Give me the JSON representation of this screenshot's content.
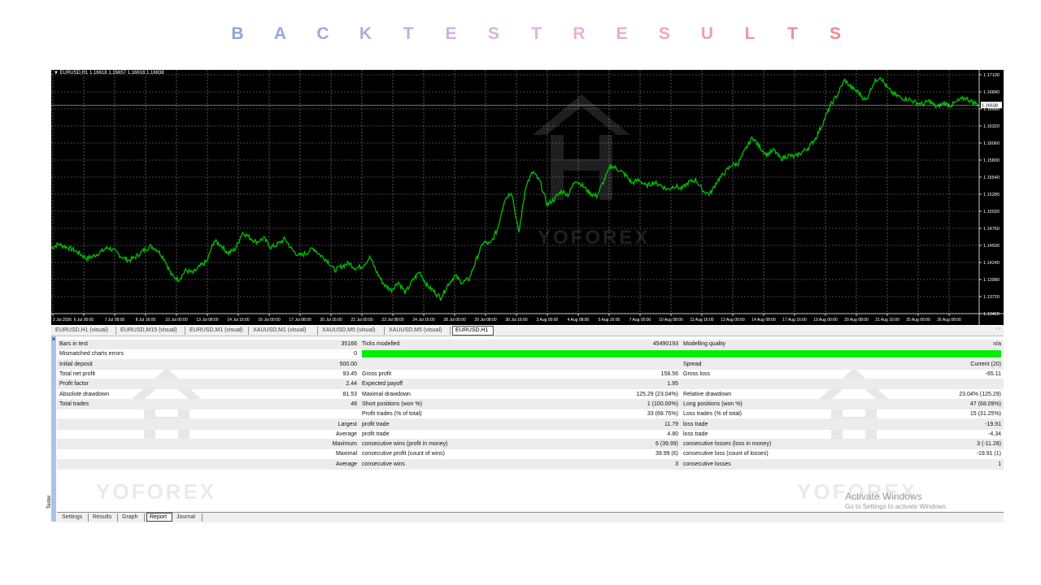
{
  "title": {
    "letters": [
      "B",
      "A",
      "C",
      "K",
      "T",
      "E",
      "S",
      "T",
      "R",
      "E",
      "S",
      "U",
      "L",
      "T",
      "S"
    ],
    "colors": [
      "#8aa6d6",
      "#98a7d8",
      "#a3a8d9",
      "#b0abdc",
      "#c0b0de",
      "#cdb3df",
      "#d7b4de",
      "#e2b3dc",
      "#e8b0d4",
      "#ecaacc",
      "#eea5c2",
      "#ef9eb4",
      "#ef97a7",
      "#ef909b",
      "#ef8a90"
    ]
  },
  "chart": {
    "symbol_line": "▼ EURUSD,H1  1.16618 1.16657 1.16616 1.16638",
    "price_labels": [
      "1.17100",
      "1.16840",
      "1.16580",
      "1.16320",
      "1.16060",
      "1.15800",
      "1.15540",
      "1.15280",
      "1.15020",
      "1.14760",
      "1.14500",
      "1.14240",
      "1.13980",
      "1.13720",
      "1.13460"
    ],
    "price_range": [
      1.1346,
      1.171
    ],
    "current_price": 1.16638,
    "current_price_label": "1.16638",
    "time_labels": [
      "2 Jul 2026",
      "6 Jul 00:00",
      "7 Jul 08:00",
      "8 Jul 16:00",
      "10 Jul 00:00",
      "13 Jul 08:00",
      "14 Jul 16:00",
      "16 Jul 00:00",
      "17 Jul 08:00",
      "20 Jul 16:00",
      "22 Jul 00:00",
      "23 Jul 08:00",
      "24 Jul 16:00",
      "28 Jul 00:00",
      "29 Jul 08:00",
      "30 Jul 16:00",
      "3 Aug 00:00",
      "4 Aug 08:00",
      "5 Aug 16:00",
      "7 Aug 00:00",
      "10 Aug 08:00",
      "11 Aug 16:00",
      "13 Aug 00:00",
      "14 Aug 08:00",
      "17 Aug 16:00",
      "19 Aug 00:00",
      "20 Aug 08:00",
      "21 Aug 16:00",
      "25 Aug 00:00",
      "26 Aug 08:00"
    ],
    "key_prices": [
      1.1446,
      1.1452,
      1.1448,
      1.1444,
      1.1438,
      1.143,
      1.1434,
      1.144,
      1.1447,
      1.1441,
      1.1432,
      1.1427,
      1.1433,
      1.1442,
      1.1449,
      1.1443,
      1.1429,
      1.1404,
      1.1398,
      1.1412,
      1.1408,
      1.1418,
      1.1426,
      1.1457,
      1.145,
      1.1438,
      1.1445,
      1.147,
      1.1462,
      1.1455,
      1.1461,
      1.1447,
      1.1452,
      1.146,
      1.1443,
      1.1434,
      1.1438,
      1.1446,
      1.1435,
      1.1427,
      1.1412,
      1.1418,
      1.1423,
      1.1415,
      1.1419,
      1.1432,
      1.1408,
      1.139,
      1.1382,
      1.1394,
      1.1378,
      1.1396,
      1.141,
      1.139,
      1.138,
      1.137,
      1.139,
      1.1404,
      1.1393,
      1.1399,
      1.1428,
      1.1455,
      1.1452,
      1.1475,
      1.152,
      1.1532,
      1.1468,
      1.1541,
      1.1562,
      1.1547,
      1.1512,
      1.152,
      1.1533,
      1.1527,
      1.155,
      1.1541,
      1.153,
      1.1525,
      1.1548,
      1.1572,
      1.1566,
      1.1558,
      1.1545,
      1.155,
      1.154,
      1.1546,
      1.1542,
      1.1535,
      1.1541,
      1.1536,
      1.1546,
      1.155,
      1.1533,
      1.1528,
      1.1548,
      1.156,
      1.1572,
      1.1575,
      1.1596,
      1.1615,
      1.16,
      1.1588,
      1.1595,
      1.1582,
      1.1587,
      1.1585,
      1.1592,
      1.16,
      1.1615,
      1.1638,
      1.1663,
      1.168,
      1.1702,
      1.169,
      1.1683,
      1.167,
      1.1696,
      1.1708,
      1.169,
      1.168,
      1.1675,
      1.1673,
      1.1668,
      1.1665,
      1.167,
      1.166,
      1.1667,
      1.1663,
      1.167,
      1.1675,
      1.1669,
      1.1664
    ]
  },
  "chart_tabs": [
    "EURUSD,H1 (visual)",
    "EURUSD,M15 (visual)",
    "EURUSD,M1 (visual)",
    "XAUUSD,M1 (visual)",
    "XAUUSD,M5 (visual)",
    "XAUUSD,M5 (visual)",
    "EURUSD,H1"
  ],
  "chart_tab_active": 6,
  "scroll_arrows": "‹ ›",
  "tester": {
    "close": "×",
    "label": "Tester"
  },
  "report_rows": [
    [
      "Bars in test",
      "35166",
      "Ticks modelled",
      "45490193",
      "Modelling quality",
      "n/a"
    ],
    [
      "Mismatched charts errors",
      "0",
      "__BAR__",
      "",
      "",
      ""
    ],
    [
      "Initial deposit",
      "500.00",
      "",
      "",
      "Spread",
      "Current (20)"
    ],
    [
      "Total net profit",
      "93.45",
      "Gross profit",
      "158.56",
      "Gross loss",
      "-65.11"
    ],
    [
      "Profit factor",
      "2.44",
      "Expected payoff",
      "1.95",
      "",
      ""
    ],
    [
      "Absolute drawdown",
      "81.53",
      "Maximal drawdown",
      "125.29 (23.04%)",
      "Relative drawdown",
      "23.04% (125.29)"
    ],
    [
      "Total trades",
      "48",
      "Short positions (won %)",
      "1 (100.00%)",
      "Long positions (won %)",
      "47 (68.09%)"
    ],
    [
      "",
      "",
      "Profit trades (% of total)",
      "33 (68.75%)",
      "Loss trades (% of total)",
      "15 (31.25%)"
    ],
    [
      "",
      "Largest",
      "profit trade",
      "11.79",
      "loss trade",
      "-19.91"
    ],
    [
      "",
      "Average",
      "profit trade",
      "4.80",
      "loss trade",
      "-4.34"
    ],
    [
      "",
      "Maximum",
      "consecutive wins (profit in money)",
      "6 (39.99)",
      "consecutive losses (loss in money)",
      "3 (-11.28)"
    ],
    [
      "",
      "Maximal",
      "consecutive profit (count of wins)",
      "39.99 (6)",
      "consecutive loss (count of losses)",
      "-19.91 (1)"
    ],
    [
      "",
      "Average",
      "consecutive wins",
      "3",
      "consecutive losses",
      "1"
    ]
  ],
  "bottom_tabs": [
    "Settings",
    "Results",
    "Graph",
    "Report",
    "Journal"
  ],
  "bottom_tab_active": 3,
  "watermark": "YOFOREX",
  "activate": {
    "line1": "Activate Windows",
    "line2": "Go to Settings to activate Windows."
  },
  "colors": {
    "chart_bg": "#000000",
    "candle": "#00c000",
    "grid": "#8a8a8a",
    "quality_bar": "#00ee00"
  }
}
